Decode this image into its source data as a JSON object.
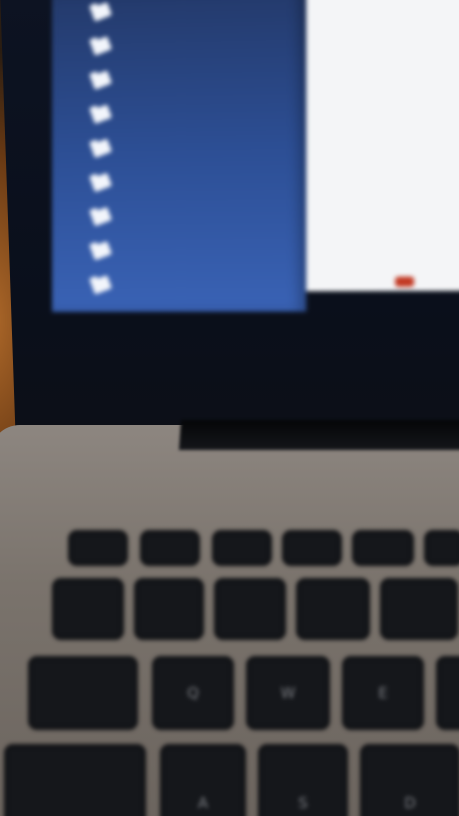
{
  "scene": {
    "screen_sidebar_color": "#2d4f95",
    "screen_content_color": "#f4f5f7",
    "laptop_body_color": "#7a736c",
    "key_color": "#15171b",
    "room_light_color": "#b06a2a"
  },
  "sidebar": {
    "folder_count": 9,
    "folder_icon": "folder-icon"
  },
  "keyboard": {
    "visible_key_letters": [
      "Q",
      "W",
      "E",
      "A",
      "S",
      "D"
    ]
  }
}
